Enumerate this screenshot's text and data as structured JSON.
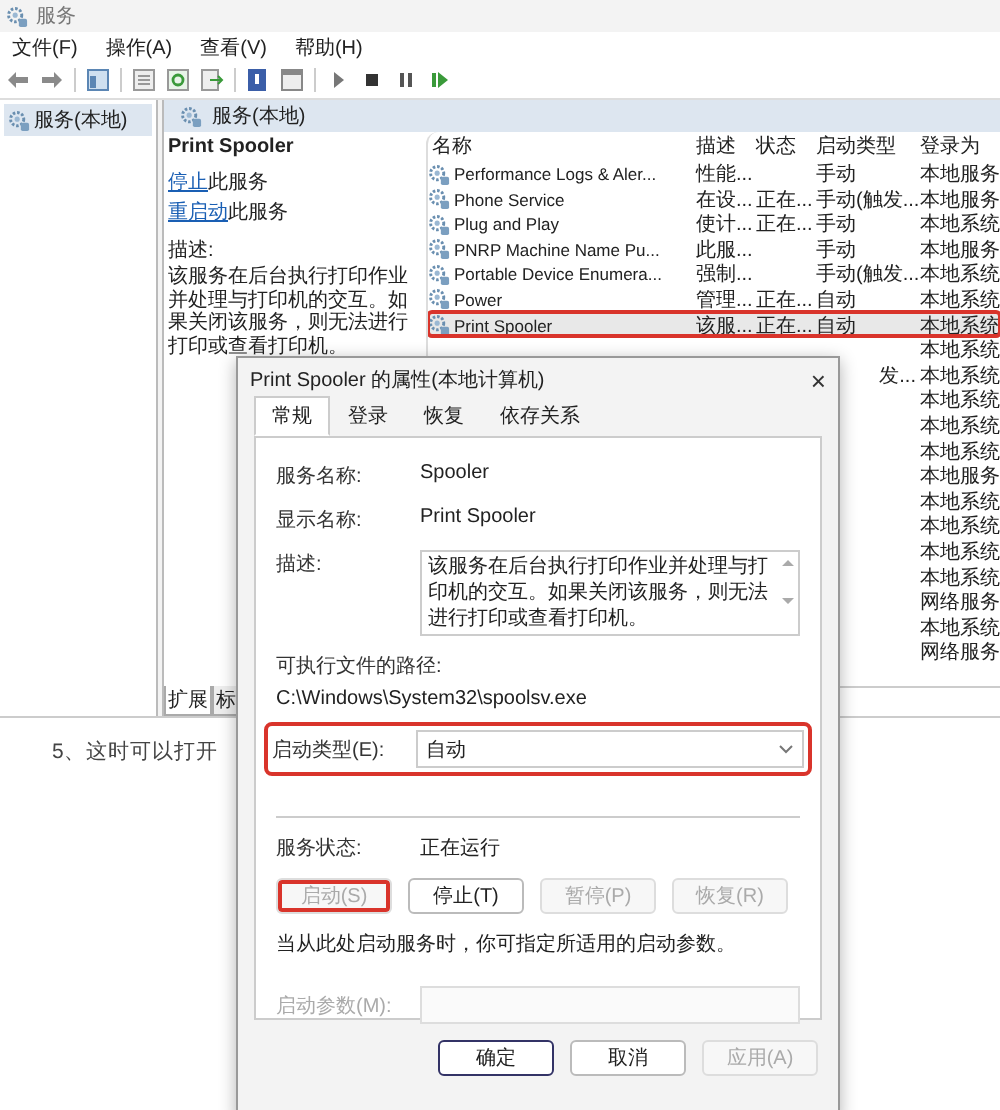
{
  "window": {
    "title": "服务"
  },
  "menu": [
    {
      "label": "文件(F)"
    },
    {
      "label": "操作(A)"
    },
    {
      "label": "查看(V)"
    },
    {
      "label": "帮助(H)"
    }
  ],
  "tree": [
    {
      "label": "服务(本地)",
      "selected": true
    }
  ],
  "panel_header": "服务(本地)",
  "details": {
    "title": "Print Spooler",
    "actions": [
      {
        "link": "停止",
        "text": "此服务"
      },
      {
        "link": "重启动",
        "text": "此服务"
      }
    ],
    "description_label": "描述:",
    "description": "该服务在后台执行打印作业并处理与打印机的交互。如果关闭该服务，则无法进行打印或查看打印机。"
  },
  "services": {
    "columns": [
      "名称",
      "描述",
      "状态",
      "启动类型",
      "登录为"
    ],
    "rows": [
      {
        "name": "Performance Logs & Aler...",
        "description": "性能...",
        "status": "",
        "startup_type": "手动",
        "logon": "本地服务",
        "selected": false,
        "highlighted": false
      },
      {
        "name": "Phone Service",
        "description": "在设...",
        "status": "正在...",
        "startup_type": "手动(触发...",
        "logon": "本地服务",
        "selected": false,
        "highlighted": false
      },
      {
        "name": "Plug and Play",
        "description": "使计...",
        "status": "正在...",
        "startup_type": "手动",
        "logon": "本地系统",
        "selected": false,
        "highlighted": false
      },
      {
        "name": "PNRP Machine Name Pu...",
        "description": "此服...",
        "status": "",
        "startup_type": "手动",
        "logon": "本地服务",
        "selected": false,
        "highlighted": false
      },
      {
        "name": "Portable Device Enumera...",
        "description": "强制...",
        "status": "",
        "startup_type": "手动(触发...",
        "logon": "本地系统",
        "selected": false,
        "highlighted": false
      },
      {
        "name": "Power",
        "description": "管理...",
        "status": "正在...",
        "startup_type": "自动",
        "logon": "本地系统",
        "selected": false,
        "highlighted": false
      },
      {
        "name": "Print Spooler",
        "description": "该服...",
        "status": "正在...",
        "startup_type": "自动",
        "logon": "本地系统",
        "selected": true,
        "highlighted": true
      },
      {
        "logon": "本地系统",
        "selected": false,
        "highlighted": false
      },
      {
        "startup_type": "发...",
        "logon": "本地系统",
        "selected": false,
        "highlighted": false
      },
      {
        "logon": "本地系统",
        "selected": false,
        "highlighted": false
      },
      {
        "logon": "本地系统",
        "selected": false,
        "highlighted": false
      },
      {
        "logon": "本地系统",
        "selected": false,
        "highlighted": false
      },
      {
        "logon": "本地服务",
        "selected": false,
        "highlighted": false
      },
      {
        "logon": "本地系统",
        "selected": false,
        "highlighted": false
      },
      {
        "logon": "本地系统",
        "selected": false,
        "highlighted": false
      },
      {
        "logon": "本地系统",
        "selected": false,
        "highlighted": false
      },
      {
        "logon": "本地系统",
        "selected": false,
        "highlighted": false
      },
      {
        "logon": "网络服务",
        "selected": false,
        "highlighted": false
      },
      {
        "logon": "本地系统",
        "selected": false,
        "highlighted": false
      },
      {
        "logon": "网络服务",
        "selected": false,
        "highlighted": false
      }
    ]
  },
  "bottom_tabs": [
    {
      "label": "扩展",
      "selected": true
    },
    {
      "label": "标",
      "selected": false
    }
  ],
  "article_text": "5、这时可以打开",
  "dialog": {
    "title": "Print Spooler 的属性(本地计算机)",
    "close": "×",
    "tabs": [
      {
        "label": "常规",
        "selected": true
      },
      {
        "label": "登录",
        "selected": false
      },
      {
        "label": "恢复",
        "selected": false
      },
      {
        "label": "依存关系",
        "selected": false
      }
    ],
    "service_name": {
      "label": "服务名称:",
      "value": "Spooler"
    },
    "display_name": {
      "label": "显示名称:",
      "value": "Print Spooler"
    },
    "description": {
      "label": "描述:",
      "value": "该服务在后台执行打印作业并处理与打印机的交互。如果关闭该服务，则无法进行打印或查看打印机。"
    },
    "path_label": "可执行文件的路径:",
    "path": "C:\\Windows\\System32\\spoolsv.exe",
    "startup_type": {
      "label": "启动类型(E):",
      "value": "自动",
      "highlighted": true
    },
    "status": {
      "label": "服务状态:",
      "value": "正在运行"
    },
    "service_buttons": [
      {
        "label": "启动(S)",
        "disabled": true,
        "highlighted": true
      },
      {
        "label": "停止(T)",
        "disabled": false,
        "highlighted": false
      },
      {
        "label": "暂停(P)",
        "disabled": true,
        "highlighted": false
      },
      {
        "label": "恢复(R)",
        "disabled": true,
        "highlighted": false
      }
    ],
    "hint": "当从此处启动服务时，你可指定所适用的启动参数。",
    "start_params": {
      "label": "启动参数(M):",
      "disabled": true
    },
    "buttons": [
      {
        "label": "确定",
        "disabled": false,
        "default": true
      },
      {
        "label": "取消",
        "disabled": false,
        "default": false
      },
      {
        "label": "应用(A)",
        "disabled": true,
        "default": false
      }
    ]
  }
}
